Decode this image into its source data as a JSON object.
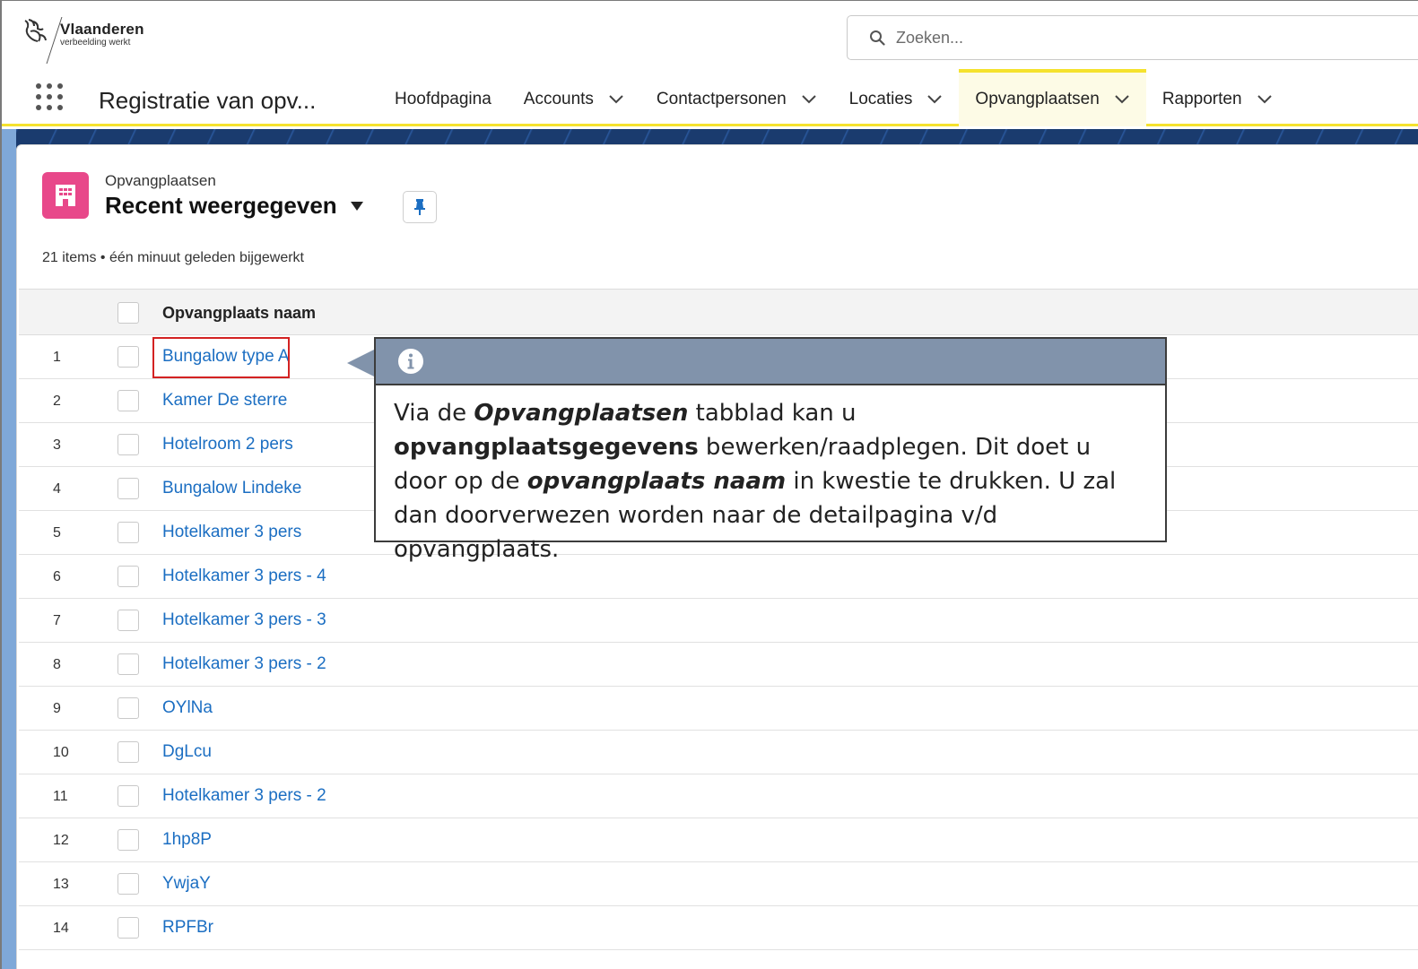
{
  "brand": {
    "title": "Vlaanderen",
    "subtitle": "verbeelding werkt"
  },
  "search": {
    "placeholder": "Zoeken..."
  },
  "nav": {
    "app_name": "Registratie van opv...",
    "tabs": [
      {
        "label": "Hoofdpagina"
      },
      {
        "label": "Accounts"
      },
      {
        "label": "Contactpersonen"
      },
      {
        "label": "Locaties"
      },
      {
        "label": "Opvangplaatsen"
      },
      {
        "label": "Rapporten"
      }
    ]
  },
  "list": {
    "object_label": "Opvangplaatsen",
    "view_title": "Recent weergegeven",
    "meta": "21 items • één minuut geleden bijgewerkt",
    "column_header": "Opvangplaats naam",
    "rows": [
      {
        "num": "1",
        "name": "Bungalow type A"
      },
      {
        "num": "2",
        "name": "Kamer De sterre"
      },
      {
        "num": "3",
        "name": "Hotelroom 2 pers"
      },
      {
        "num": "4",
        "name": "Bungalow Lindeke"
      },
      {
        "num": "5",
        "name": "Hotelkamer 3 pers"
      },
      {
        "num": "6",
        "name": "Hotelkamer 3 pers - 4"
      },
      {
        "num": "7",
        "name": "Hotelkamer 3 pers - 3"
      },
      {
        "num": "8",
        "name": "Hotelkamer 3 pers - 2"
      },
      {
        "num": "9",
        "name": "OYlNa"
      },
      {
        "num": "10",
        "name": "DgLcu"
      },
      {
        "num": "11",
        "name": "Hotelkamer 3 pers - 2"
      },
      {
        "num": "12",
        "name": "1hp8P"
      },
      {
        "num": "13",
        "name": "YwjaY"
      },
      {
        "num": "14",
        "name": "RPFBr"
      }
    ]
  },
  "callout": {
    "t1": "Via de ",
    "t2": "Opvangplaatsen",
    "t3": " tabblad kan u ",
    "t4": "opvangplaatsgegevens",
    "t5": " bewerken/raadplegen. Dit doet u door op de ",
    "t6": "opvangplaats naam",
    "t7": " in kwestie te drukken. U zal dan doorverwezen worden naar de detailpagina v/d opvangplaats."
  },
  "colors": {
    "accent": "#f5e22e",
    "link": "#1b6ec2",
    "object_icon": "#e8488a",
    "callout_header": "#8193ab",
    "highlight": "#d32222"
  },
  "icons": [
    "vlaanderen-lion-logo",
    "search-icon",
    "app-launcher-icon",
    "chevron-down-icon",
    "building-icon",
    "caret-down-icon",
    "pin-icon",
    "info-icon"
  ]
}
